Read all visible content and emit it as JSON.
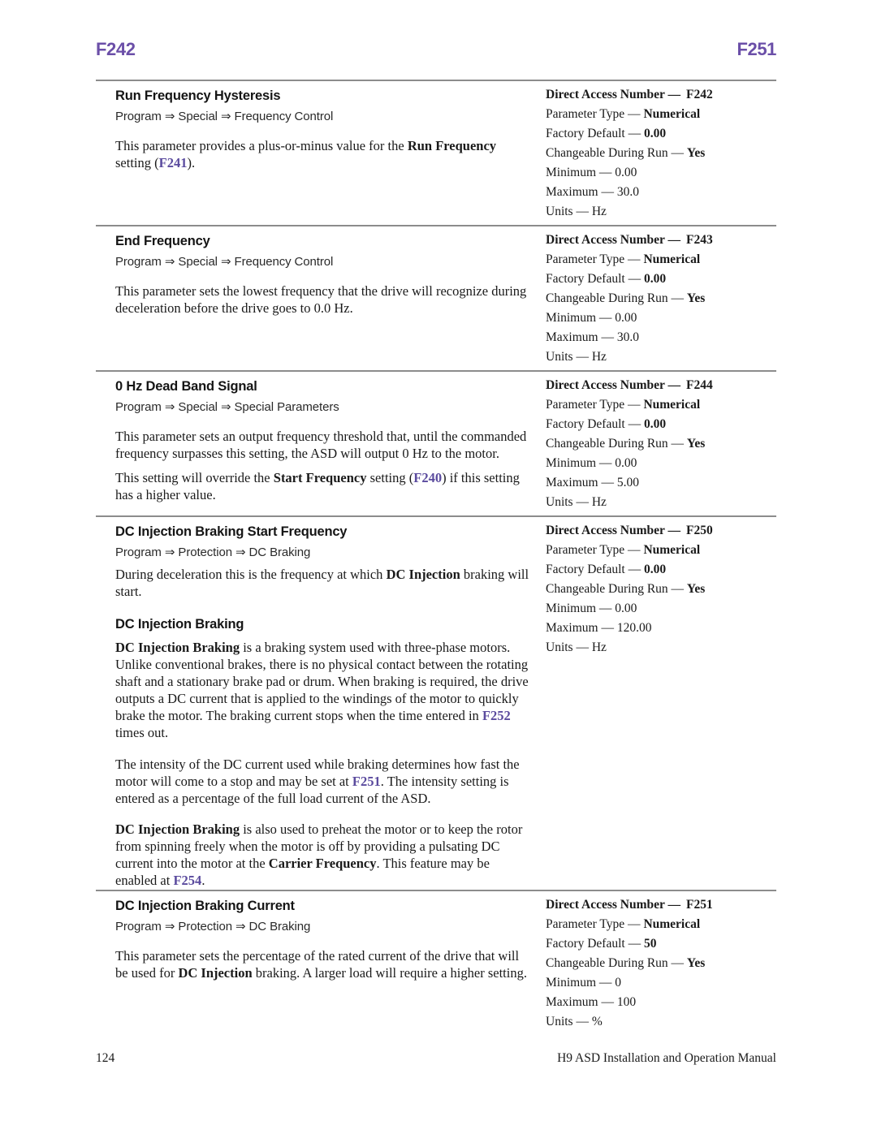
{
  "running_head": {
    "left_folio": "F242",
    "right_folio": "F251",
    "accent_color": "#6b4fa8"
  },
  "reference_color": "#5b4b9e",
  "spec_labels": {
    "direct_access_number": "Direct Access Number —",
    "parameter_type": "Parameter Type —",
    "factory_default": "Factory Default —",
    "changeable_during_run": "Changeable During Run —",
    "minimum": "Minimum —",
    "maximum": "Maximum —",
    "units": "Units —"
  },
  "sections": [
    {
      "title": "Run Frequency Hysteresis",
      "path": "Program ⇒ Special ⇒ Frequency Control",
      "body_1_a": "This parameter provides a plus-or-minus value for the ",
      "body_1_b": "Run Frequency",
      "body_1_c": " setting (",
      "body_1_ref": "F241",
      "body_1_d": ").",
      "spec": {
        "direct_access_number": "F242",
        "parameter_type": "Numerical",
        "factory_default": "0.00",
        "changeable_during_run": "Yes",
        "minimum": "0.00",
        "maximum": "30.0",
        "units": "Hz"
      }
    },
    {
      "title": "End Frequency",
      "path": "Program ⇒ Special ⇒ Frequency Control",
      "body_1": "This parameter sets the lowest frequency that the drive will recognize during deceleration before the drive goes to 0.0 Hz.",
      "spec": {
        "direct_access_number": "F243",
        "parameter_type": "Numerical",
        "factory_default": "0.00",
        "changeable_during_run": "Yes",
        "minimum": "0.00",
        "maximum": "30.0",
        "units": "Hz"
      }
    },
    {
      "title": "0 Hz Dead Band Signal",
      "path": "Program ⇒ Special ⇒ Special Parameters",
      "body_1": "This parameter sets an output frequency threshold that, until the commanded frequency surpasses this setting, the ASD will output 0 Hz to the motor.",
      "body_2_a": "This setting will override the ",
      "body_2_b": "Start Frequency",
      "body_2_c": " setting (",
      "body_2_ref": "F240",
      "body_2_d": ") if this setting has a higher value.",
      "spec": {
        "direct_access_number": "F244",
        "parameter_type": "Numerical",
        "factory_default": "0.00",
        "changeable_during_run": "Yes",
        "minimum": "0.00",
        "maximum": "5.00",
        "units": "Hz"
      }
    },
    {
      "title": "DC Injection Braking Start Frequency",
      "path": "Program ⇒ Protection ⇒ DC Braking",
      "body_1_a": "During deceleration this is the frequency at which ",
      "body_1_b": "DC Injection",
      "body_1_c": " braking will start.",
      "subsection": {
        "title": "DC Injection Braking",
        "p1_a": "DC Injection Braking",
        "p1_b": " is a braking system used with three-phase motors. Unlike conventional brakes, there is no physical contact between the rotating shaft and a stationary brake pad or drum. When braking is required, the drive outputs a DC current that is applied to the windings of the motor to quickly brake the motor. The braking current stops when the time entered in ",
        "p1_ref": "F252",
        "p1_c": " times out.",
        "p2_a": "The intensity of the DC current used while braking determines how fast the motor will come to a stop and may be set at ",
        "p2_ref": "F251",
        "p2_b": ". The intensity setting is entered as a percentage of the full load current of the ASD.",
        "p3_a": "DC Injection Braking",
        "p3_b": " is also used to preheat the motor or to keep the rotor from spinning freely when the motor is off by providing a pulsating DC current into the motor at the ",
        "p3_c": "Carrier Frequency",
        "p3_d": ". This feature may be enabled at ",
        "p3_ref": "F254",
        "p3_e": "."
      },
      "spec": {
        "direct_access_number": "F250",
        "parameter_type": "Numerical",
        "factory_default": "0.00",
        "changeable_during_run": "Yes",
        "minimum": "0.00",
        "maximum": "120.00",
        "units": "Hz"
      }
    },
    {
      "title": "DC Injection Braking Current",
      "path": "Program ⇒ Protection ⇒ DC Braking",
      "body_1_a": "This parameter sets the percentage of the rated current of the drive that will be used for ",
      "body_1_b": "DC Injection",
      "body_1_c": " braking. A larger load will require a higher setting.",
      "spec": {
        "direct_access_number": "F251",
        "parameter_type": "Numerical",
        "factory_default": "50",
        "changeable_during_run": "Yes",
        "minimum": "0",
        "maximum": "100",
        "units": "%"
      }
    }
  ],
  "footer": {
    "page_number": "124",
    "manual_title": "H9 ASD Installation and Operation Manual"
  }
}
